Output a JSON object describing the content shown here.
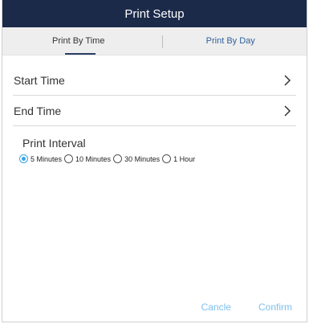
{
  "title": "Print Setup",
  "tabs": [
    {
      "label": "Print By Time",
      "active": true
    },
    {
      "label": "Print By Day",
      "active": false
    }
  ],
  "rows": [
    {
      "label": "Start Time"
    },
    {
      "label": "End Time"
    }
  ],
  "interval": {
    "label": "Print Interval",
    "options": [
      "5 Minutes",
      "10 Minutes",
      "30 Minutes",
      "1 Hour"
    ],
    "selected": "5 Minutes"
  },
  "footer": {
    "cancel_label": "Cancle",
    "confirm_label": "Confirm"
  },
  "colors": {
    "title_bar": "#1c2a4a",
    "accent": "#3aa4e6",
    "button_text": "#7ec0ec",
    "tab_inactive_text": "#2f5f9c"
  },
  "icons": {
    "row_chevron": "chevron-right-icon"
  }
}
